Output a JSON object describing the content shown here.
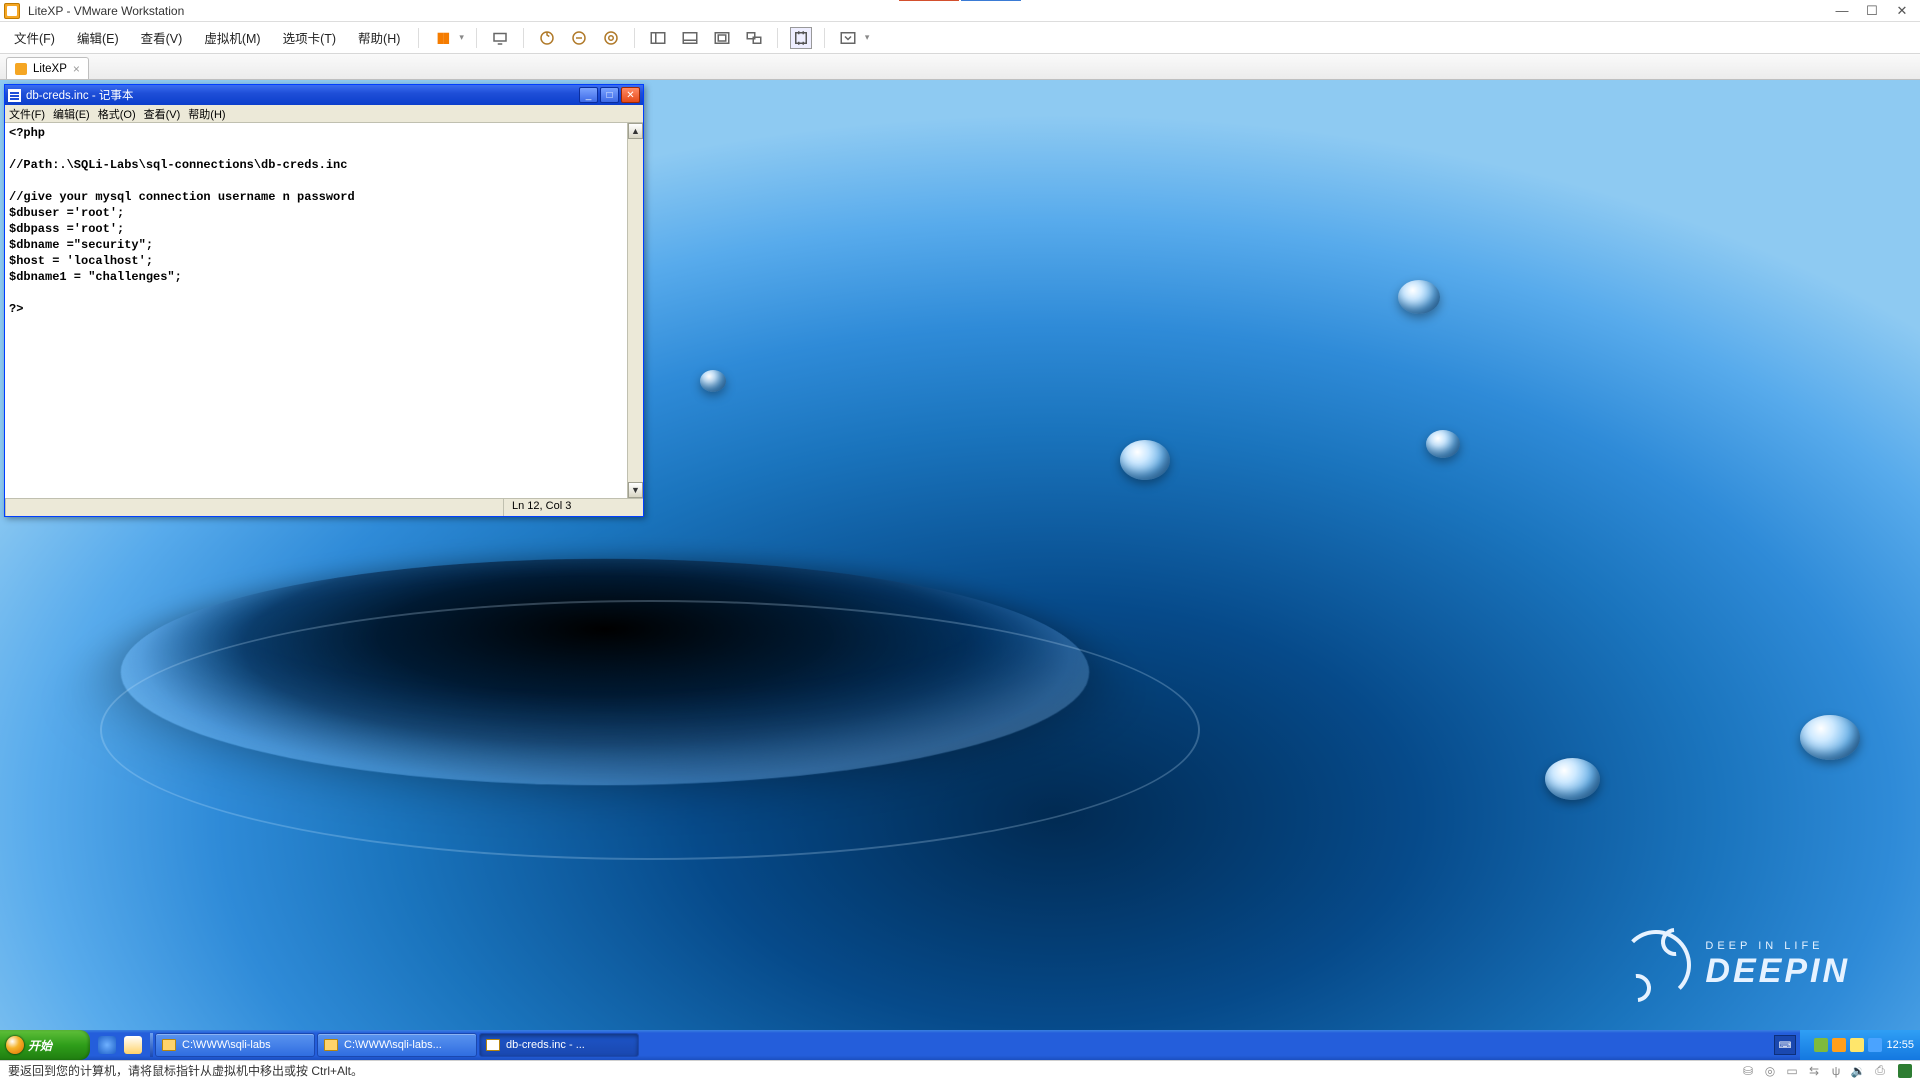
{
  "host": {
    "title": "LiteXP - VMware Workstation",
    "menu": {
      "file": "文件(F)",
      "edit": "编辑(E)",
      "view": "查看(V)",
      "vm": "虚拟机(M)",
      "tabs": "选项卡(T)",
      "help": "帮助(H)"
    },
    "tab": {
      "label": "LiteXP"
    },
    "status_msg": "要返回到您的计算机，请将鼠标指针从虚拟机中移出或按 Ctrl+Alt。"
  },
  "notepad": {
    "title": "db-creds.inc - 记事本",
    "menu": {
      "file": "文件(F)",
      "edit": "编辑(E)",
      "format": "格式(O)",
      "view": "查看(V)",
      "help": "帮助(H)"
    },
    "content": "<?php\n\n//Path:.\\SQLi-Labs\\sql-connections\\db-creds.inc\n\n//give your mysql connection username n password\n$dbuser ='root';\n$dbpass ='root';\n$dbname =\"security\";\n$host = 'localhost';\n$dbname1 = \"challenges\";\n\n?>",
    "status": "Ln 12, Col 3"
  },
  "xp": {
    "start": "开始",
    "tasks": [
      {
        "label": "C:\\WWW\\sqli-labs"
      },
      {
        "label": "C:\\WWW\\sqli-labs..."
      },
      {
        "label": "db-creds.inc - ..."
      }
    ],
    "lang": "▭",
    "clock": "12:55"
  },
  "deepin": {
    "tag": "DEEP  IN  LIFE",
    "name": "DEEPIN"
  }
}
